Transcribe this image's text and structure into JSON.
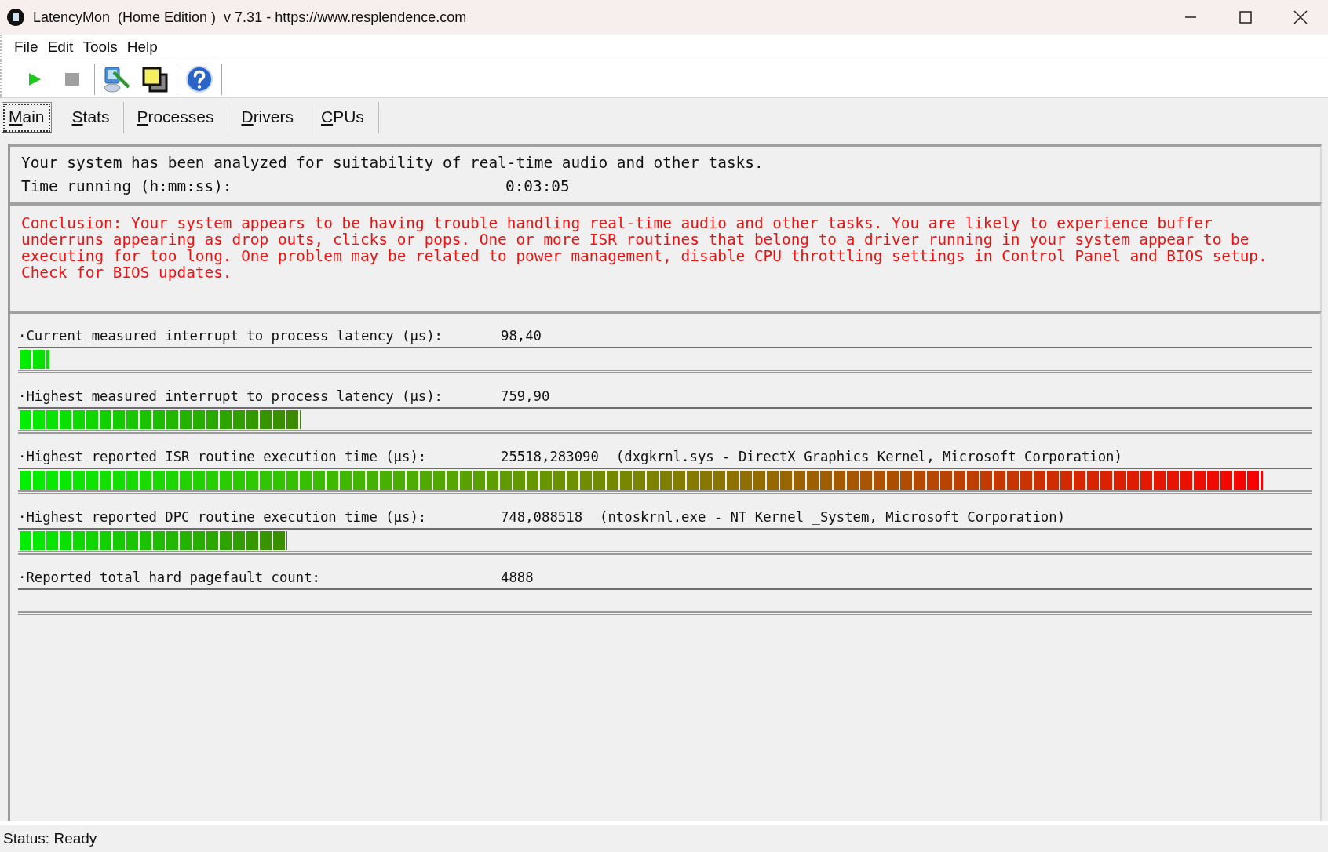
{
  "window": {
    "title": "LatencyMon  (Home Edition )  v 7.31 - https://www.resplendence.com"
  },
  "menu": [
    {
      "label": "File"
    },
    {
      "label": "Edit"
    },
    {
      "label": "Tools"
    },
    {
      "label": "Help"
    }
  ],
  "toolbar": [
    {
      "kind": "play"
    },
    {
      "kind": "stop"
    },
    {
      "kind": "separator"
    },
    {
      "kind": "tool"
    },
    {
      "kind": "windows"
    },
    {
      "kind": "separator"
    },
    {
      "kind": "help"
    },
    {
      "kind": "separator"
    }
  ],
  "tabs": [
    {
      "label": "Main",
      "selected": true
    },
    {
      "label": "Stats",
      "selected": false
    },
    {
      "label": "Processes",
      "selected": false
    },
    {
      "label": "Drivers",
      "selected": false
    },
    {
      "label": "CPUs",
      "selected": false
    }
  ],
  "summary": {
    "text": "Your system has been analyzed for suitability of real-time audio and other tasks.",
    "time_label": "Time running (h:mm:ss):",
    "time_value": "0:03:05"
  },
  "conclusion": "Conclusion: Your system appears to be having trouble handling real-time audio and other tasks. You are likely to experience buffer underruns appearing as drop outs, clicks or pops. One or more ISR routines that belong to a driver running in your system appear to be executing for too long. One problem may be related to power management, disable CPU throttling settings in Control Panel and BIOS setup. Check for BIOS updates.",
  "meters": [
    {
      "label": "·Current measured interrupt to process latency (µs):",
      "value": "98,40",
      "level": 0.023
    },
    {
      "label": "·Highest measured interrupt to process latency (µs):",
      "value": "759,90",
      "level": 0.218
    },
    {
      "label": "·Highest reported ISR routine execution time (µs):",
      "value": "25518,283090",
      "detail": "(dxgkrnl.sys - DirectX Graphics Kernel, Microsoft Corporation)",
      "level": 0.962
    },
    {
      "label": "·Highest reported DPC routine execution time (µs):",
      "value": "748,088518",
      "detail": "(ntoskrnl.exe - NT Kernel _System, Microsoft Corporation)",
      "level": 0.207
    },
    {
      "label": "·Reported total hard pagefault count:",
      "value": "4888"
    }
  ],
  "status_bar": "Status: Ready"
}
